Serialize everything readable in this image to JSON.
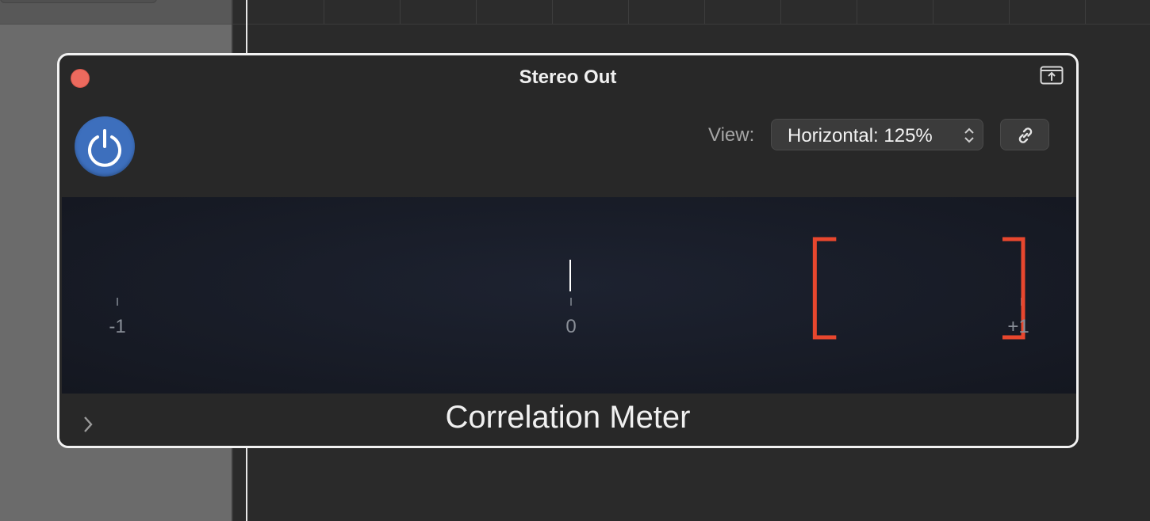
{
  "window": {
    "title": "Stereo Out"
  },
  "toolbar": {
    "view_label": "View:",
    "view_value": "Horizontal: 125%"
  },
  "meter": {
    "scale_labels": [
      "-1",
      "0",
      "+1"
    ],
    "correlation_value": 0,
    "range_min": 0.54,
    "range_max": 1.0
  },
  "footer": {
    "plugin_name": "Correlation Meter"
  },
  "colors": {
    "accent_power": "#3d6fbd",
    "bracket": "#e8472e",
    "close_button": "#ec6a5e"
  },
  "icons": {
    "power": "power-icon",
    "link": "link-icon",
    "float": "float-window-icon",
    "expand": "chevron-right-icon"
  }
}
